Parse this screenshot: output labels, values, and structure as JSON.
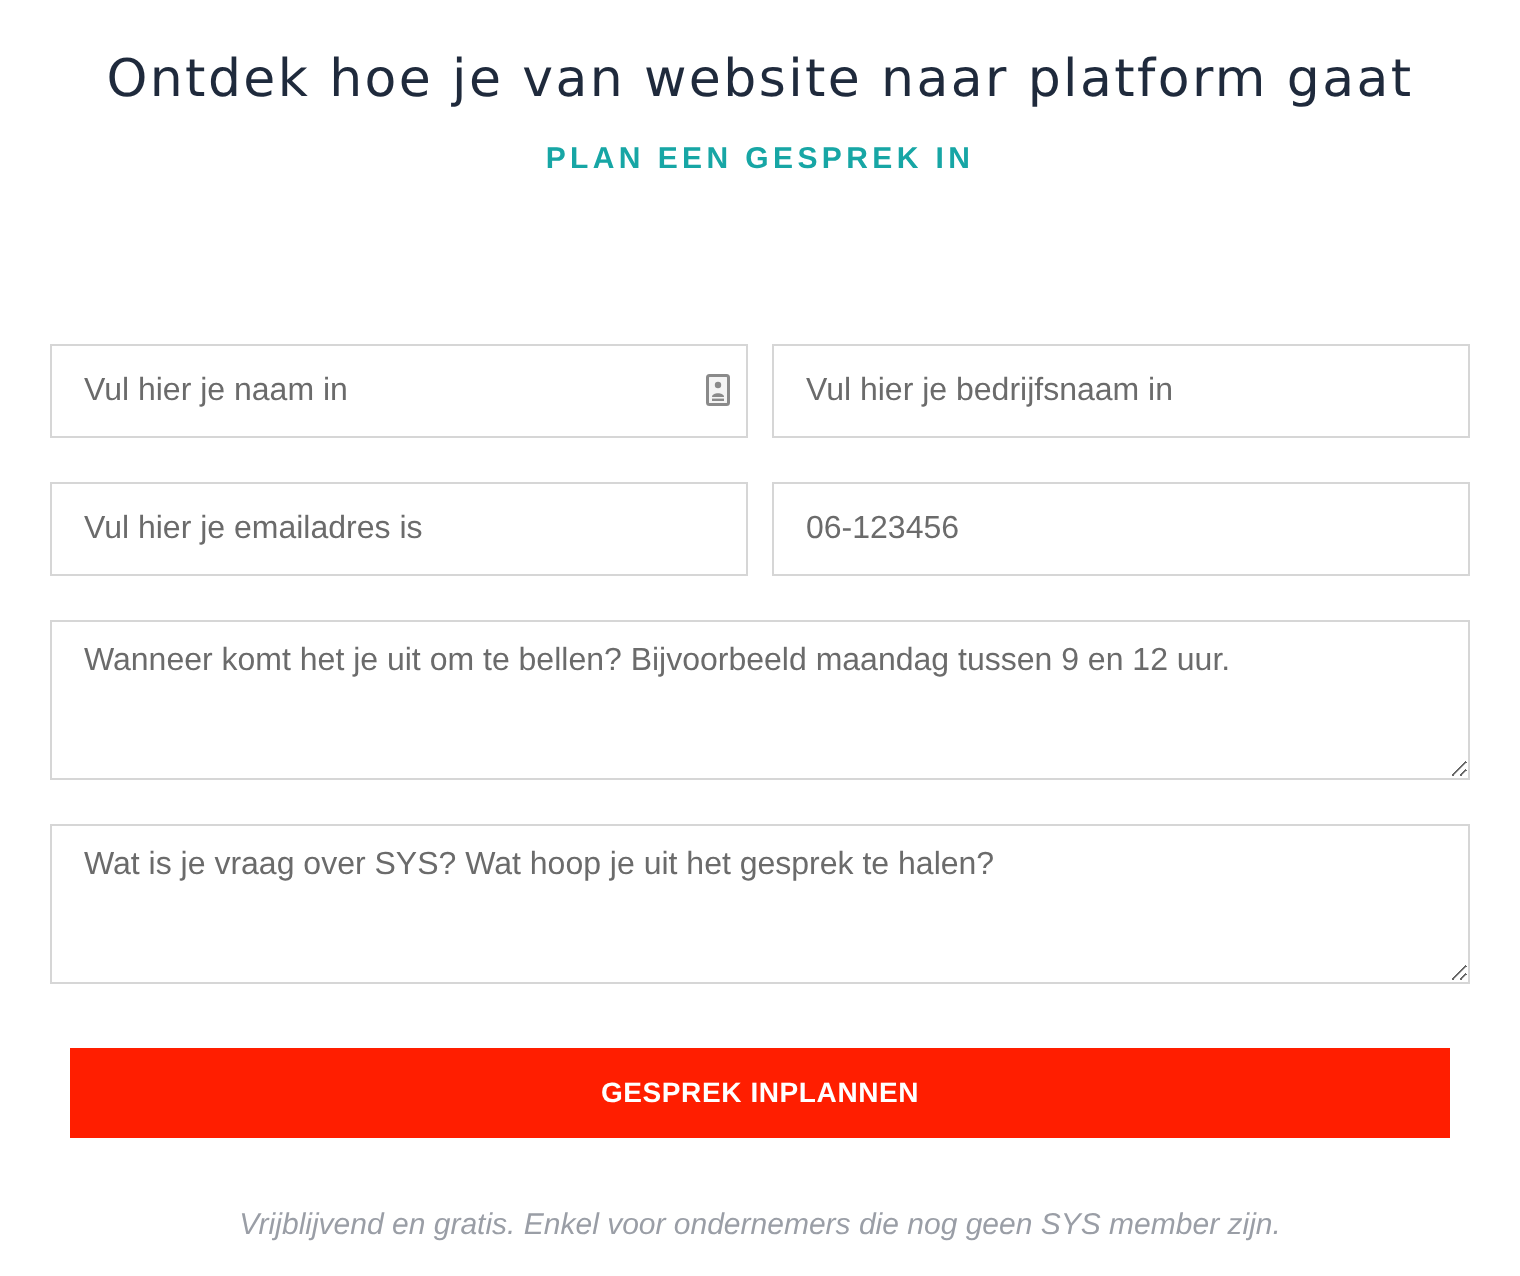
{
  "heading": "Ontdek hoe je van website naar platform gaat",
  "subheading": "PLAN EEN GESPREK IN",
  "fields": [
    {
      "kind": "input",
      "placeholder": "Vul hier je naam in",
      "autofill_icon": true
    },
    {
      "kind": "input",
      "placeholder": "Vul hier je bedrijfsnaam in",
      "autofill_icon": false
    },
    {
      "kind": "input",
      "placeholder": "Vul hier je emailadres is",
      "autofill_icon": false
    },
    {
      "kind": "input",
      "placeholder": "06-123456",
      "autofill_icon": false
    },
    {
      "kind": "textarea",
      "placeholder": "Wanneer komt het je uit om te bellen? Bijvoorbeeld maandag tussen 9 en 12 uur."
    },
    {
      "kind": "textarea",
      "placeholder": "Wat is je vraag over SYS? Wat hoop je uit het gesprek te halen?"
    }
  ],
  "submit_button": "GESPREK INPLANNEN",
  "footnote": "Vrijblijvend en gratis. Enkel voor ondernemers die nog geen SYS member zijn."
}
